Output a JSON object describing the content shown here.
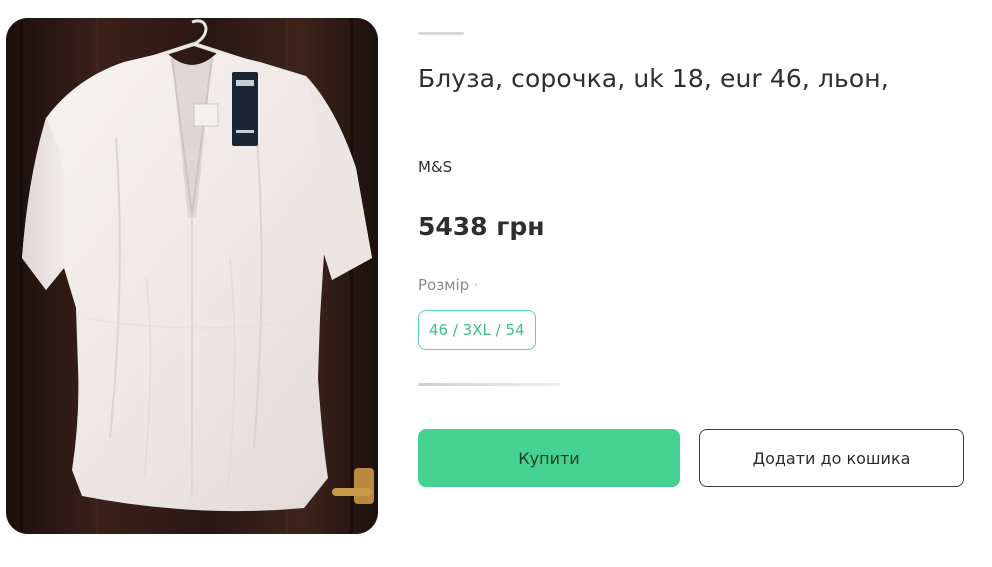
{
  "product": {
    "title": "Блуза, сорочка, uk 18, eur 46, льон,",
    "brand": "M&S",
    "price": "5438 грн",
    "image_alt": "white-linen-blouse-photo"
  },
  "size": {
    "label": "Розмір",
    "selected": "46 / 3XL / 54"
  },
  "actions": {
    "buy_label": "Купити",
    "add_to_cart_label": "Додати до кошика"
  },
  "colors": {
    "accent_green": "#45d18f",
    "chip_border": "#58d7a0",
    "chip_text": "#3fbf87",
    "text_dark": "#2e2e2e",
    "text_muted": "#8a8a8a"
  }
}
